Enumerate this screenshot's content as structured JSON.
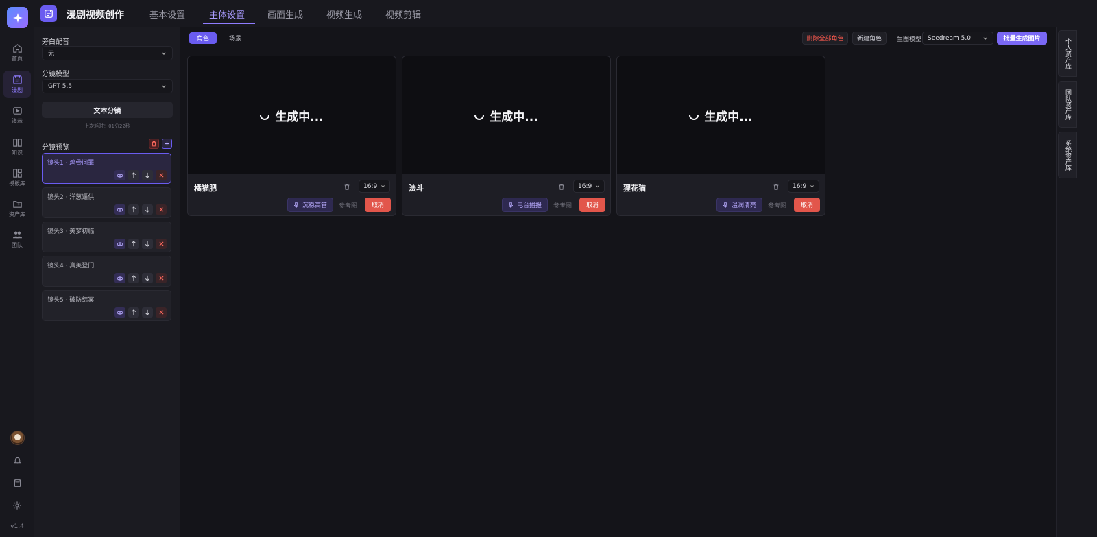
{
  "app": {
    "title": "漫剧视频创作",
    "version": "v1.4"
  },
  "rail": {
    "items": [
      {
        "label": "首页",
        "icon": "home-icon"
      },
      {
        "label": "漫剧",
        "icon": "film-icon"
      },
      {
        "label": "演示",
        "icon": "play-icon"
      },
      {
        "label": "知识",
        "icon": "book-icon"
      },
      {
        "label": "模板库",
        "icon": "layout-icon"
      },
      {
        "label": "资产库",
        "icon": "folder-icon"
      },
      {
        "label": "团队",
        "icon": "team-icon"
      }
    ]
  },
  "tabs": [
    {
      "label": "基本设置"
    },
    {
      "label": "主体设置"
    },
    {
      "label": "画面生成"
    },
    {
      "label": "视频生成"
    },
    {
      "label": "视频剪辑"
    }
  ],
  "panel": {
    "narration_label": "旁白配音",
    "narration_value": "无",
    "model_label": "分镜模型",
    "model_value": "GPT 5.5",
    "split_button": "文本分镜",
    "last_time": "上次耗时：01分22秒",
    "preview_label": "分镜预览",
    "shots": [
      {
        "title": "镜头1 · 鸡骨问罪"
      },
      {
        "title": "镜头2 · 洋葱逼供"
      },
      {
        "title": "镜头3 · 美梦初临"
      },
      {
        "title": "镜头4 · 真美登门"
      },
      {
        "title": "镜头5 · 破防结案"
      }
    ]
  },
  "main": {
    "subtabs": [
      {
        "label": "角色"
      },
      {
        "label": "场景"
      }
    ],
    "delete_all": "删除全部角色",
    "new_role": "新建角色",
    "image_model_label": "生图模型",
    "image_model_value": "Seedream 5.0",
    "batch_button": "批量生成图片",
    "cards": [
      {
        "name": "橘猫肥",
        "status": "生成中...",
        "ratio": "16:9",
        "voice": "沉稳高管",
        "ref": "参考图",
        "cancel": "取消"
      },
      {
        "name": "法斗",
        "status": "生成中...",
        "ratio": "16:9",
        "voice": "电台播报",
        "ref": "参考图",
        "cancel": "取消"
      },
      {
        "name": "狸花猫",
        "status": "生成中...",
        "ratio": "16:9",
        "voice": "温润清亮",
        "ref": "参考图",
        "cancel": "取消"
      }
    ]
  },
  "side_tabs": [
    {
      "label": "个人资产库"
    },
    {
      "label": "团队资产库"
    },
    {
      "label": "系统资产库"
    }
  ],
  "colors": {
    "accent": "#6a5cf0",
    "danger": "#e2564b",
    "background": "#141419"
  }
}
